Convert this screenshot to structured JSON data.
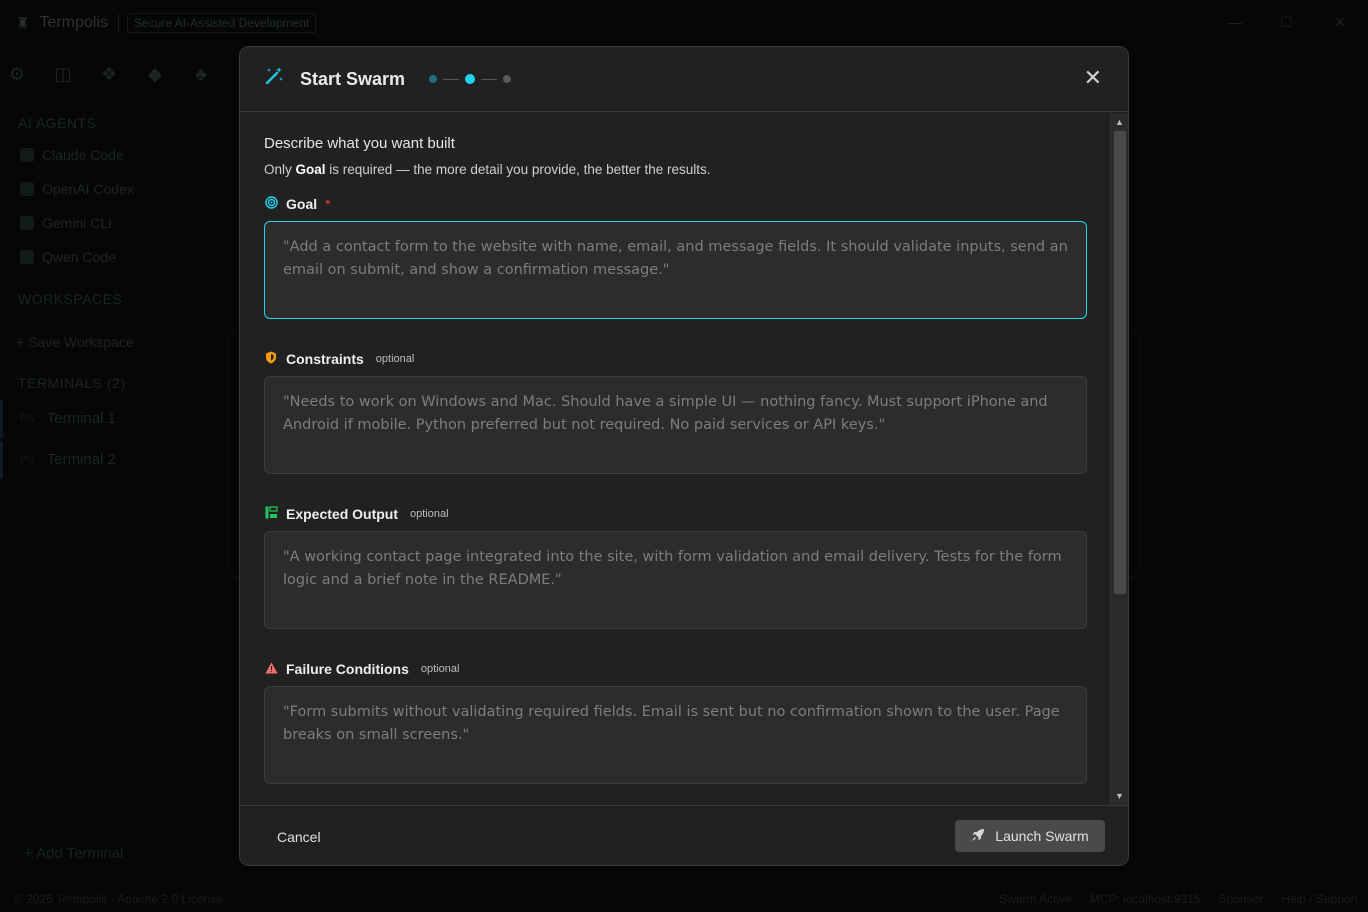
{
  "app": {
    "name": "Termpolis",
    "badge": "Secure AI-Assisted Development",
    "sidebar": {
      "agents_header": "AI AGENTS",
      "agents": [
        "Claude Code",
        "OpenAI Codex",
        "Gemini CLI",
        "Qwen Code"
      ],
      "workspaces_header": "WORKSPACES",
      "save_workspace": "+ Save Workspace",
      "terminals_header": "TERMINALS",
      "terminals_count": "(2)",
      "terminals": [
        {
          "prefix": "PS",
          "name": "Terminal 1"
        },
        {
          "prefix": "PS",
          "name": "Terminal 2"
        }
      ],
      "add_terminal": "+ Add Terminal"
    },
    "footer": {
      "copyright": "© 2026 Termpolis · Apache 2.0 License",
      "swarm": "Swarm Active",
      "mcp": "MCP: localhost:9315",
      "sponsor": "Sponsor",
      "help": "Help / Support"
    }
  },
  "modal": {
    "title": "Start Swarm",
    "steps": {
      "total": 3,
      "current": 2
    },
    "close_label": "✕",
    "intro_title": "Describe what you want built",
    "intro_prefix": "Only ",
    "intro_bold": "Goal",
    "intro_suffix": " is required — the more detail you provide, the better the results.",
    "fields": {
      "goal": {
        "label": "Goal",
        "required_mark": "*",
        "placeholder": "\"Add a contact form to the website with name, email, and message fields. It should validate inputs, send an email on submit, and show a confirmation message.\"",
        "icon": "target-icon",
        "icon_color": "#22d3ee"
      },
      "constraints": {
        "label": "Constraints",
        "optional_tag": "optional",
        "placeholder": "\"Needs to work on Windows and Mac. Should have a simple UI — nothing fancy. Must support iPhone and Android if mobile. Python preferred but not required. No paid services or API keys.\"",
        "icon": "shield-icon",
        "icon_color": "#f59e0b"
      },
      "expected_output": {
        "label": "Expected Output",
        "optional_tag": "optional",
        "placeholder": "\"A working contact page integrated into the site, with form validation and email delivery. Tests for the form logic and a brief note in the README.\"",
        "icon": "list-tree-icon",
        "icon_color": "#22c55e"
      },
      "failure_conditions": {
        "label": "Failure Conditions",
        "optional_tag": "optional",
        "placeholder": "\"Form submits without validating required fields. Email is sent but no confirmation shown to the user. Page breaks on small screens.\"",
        "icon": "warning-icon",
        "icon_color": "#f87171"
      }
    },
    "footer": {
      "cancel": "Cancel",
      "launch": "Launch Swarm"
    }
  }
}
